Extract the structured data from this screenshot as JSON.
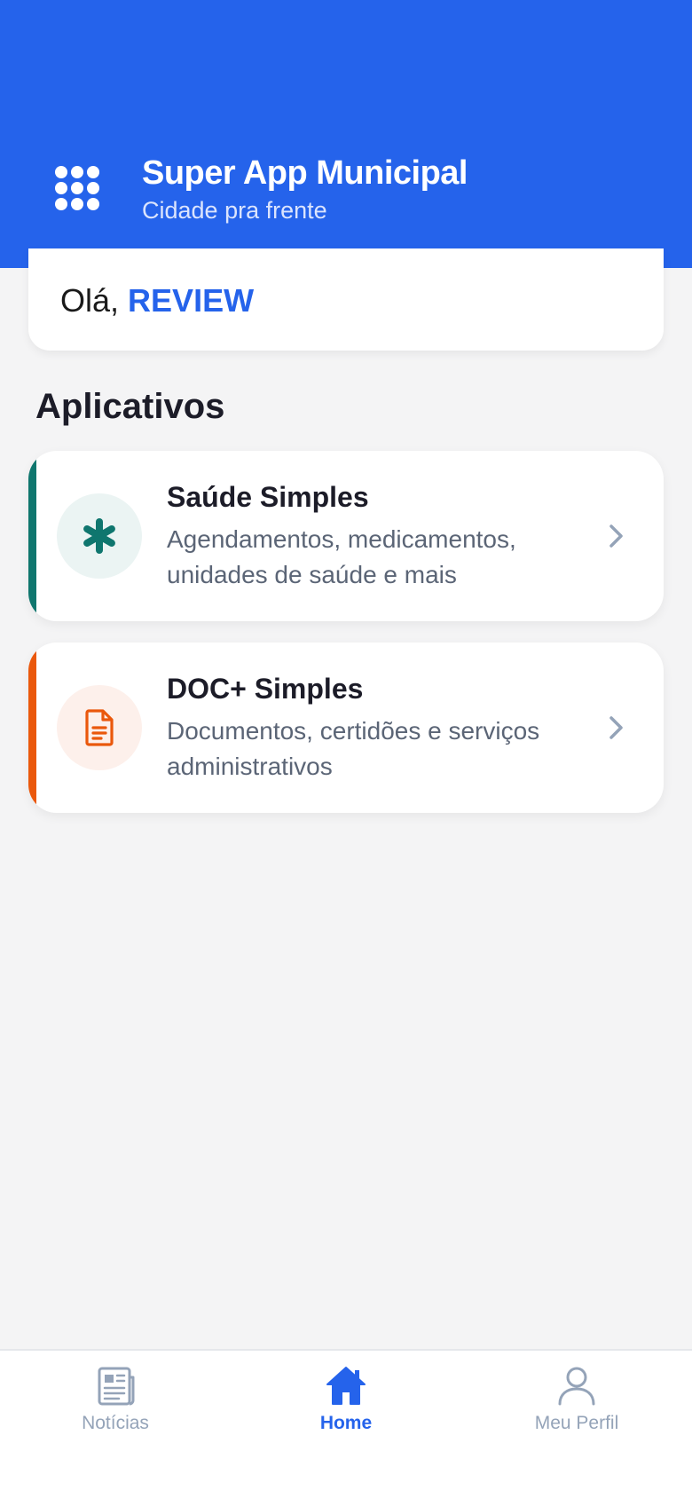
{
  "header": {
    "title": "Super App Municipal",
    "subtitle": "Cidade pra frente",
    "menu_icon": "grid-dots-icon",
    "background": "#2563eb"
  },
  "greeting": {
    "prefix": "Olá,",
    "name": "REVIEW"
  },
  "apps_section": {
    "title": "Aplicativos",
    "items": [
      {
        "title": "Saúde Simples",
        "description": "Agendamentos, medicamentos, unidades de saúde e mais",
        "icon": "asterisk-icon",
        "accent": "#0f766e",
        "icon_bg": "#ebf4f3"
      },
      {
        "title": "DOC+ Simples",
        "description": "Documentos, certidões e serviços administrativos",
        "icon": "document-icon",
        "accent": "#ea580c",
        "icon_bg": "#fdf0eb"
      }
    ]
  },
  "bottom_nav": {
    "items": [
      {
        "label": "Notícias",
        "icon": "newspaper-icon",
        "active": false
      },
      {
        "label": "Home",
        "icon": "home-icon",
        "active": true
      },
      {
        "label": "Meu Perfil",
        "icon": "user-icon",
        "active": false
      }
    ],
    "active_color": "#2563eb",
    "inactive_color": "#94a3b8"
  }
}
